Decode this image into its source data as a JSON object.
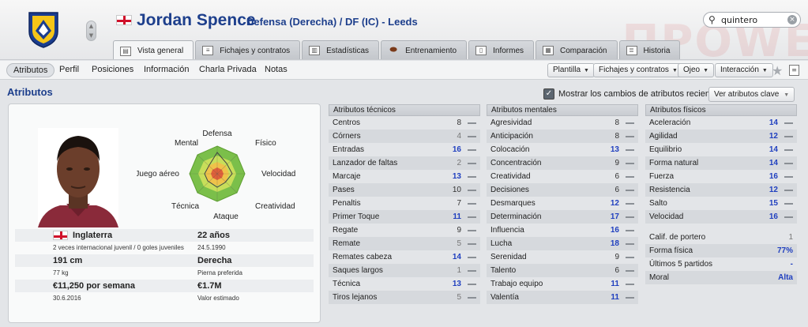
{
  "header": {
    "player_name": "Jordan Spence",
    "player_sub": "Defensa (Derecha) / DF (IC) - Leeds",
    "search_value": "quintero",
    "tabs": [
      {
        "label": "Vista general",
        "active": true
      },
      {
        "label": "Fichajes y contratos"
      },
      {
        "label": "Estadísticas"
      },
      {
        "label": "Entrenamiento"
      },
      {
        "label": "Informes"
      },
      {
        "label": "Comparación"
      },
      {
        "label": "Historia"
      }
    ]
  },
  "subnav": {
    "items": [
      "Atributos",
      "Perfil",
      "Posiciones",
      "Información",
      "Charla Privada",
      "Notas"
    ],
    "dropdowns": [
      "Plantilla",
      "Fichajes y contratos",
      "Ojeo",
      "Interacción"
    ]
  },
  "section": {
    "title": "Atributos",
    "checkbox_label": "Mostrar los cambios de atributos recientes",
    "key_button": "Ver atributos clave"
  },
  "radar_labels": {
    "top": "Defensa",
    "top_left": "Mental",
    "top_right": "Físico",
    "left": "Juego aéreo",
    "right": "Velocidad",
    "bottom_left": "Técnica",
    "bottom_right": "Creatividad",
    "bottom": "Ataque"
  },
  "profile": {
    "nationality": "Inglaterra",
    "caps": "2 veces internacional juvenil / 0 goles juveniles",
    "age": "22 años",
    "dob": "24.5.1990",
    "height": "191 cm",
    "weight": "77 kg",
    "foot": "Derecha",
    "foot_label": "Pierna preferida",
    "wage": "€11,250 por semana",
    "contract_end": "30.6.2016",
    "value": "€1.7M",
    "value_label": "Valor estimado"
  },
  "technical": {
    "title": "Atributos técnicos",
    "rows": [
      {
        "name": "Centros",
        "value": "8"
      },
      {
        "name": "Córners",
        "value": "4"
      },
      {
        "name": "Entradas",
        "value": "16"
      },
      {
        "name": "Lanzador de faltas",
        "value": "2"
      },
      {
        "name": "Marcaje",
        "value": "13"
      },
      {
        "name": "Pases",
        "value": "10"
      },
      {
        "name": "Penaltis",
        "value": "7"
      },
      {
        "name": "Primer Toque",
        "value": "11"
      },
      {
        "name": "Regate",
        "value": "9"
      },
      {
        "name": "Remate",
        "value": "5"
      },
      {
        "name": "Remates cabeza",
        "value": "14"
      },
      {
        "name": "Saques largos",
        "value": "1"
      },
      {
        "name": "Técnica",
        "value": "13"
      },
      {
        "name": "Tiros lejanos",
        "value": "5"
      }
    ]
  },
  "mental": {
    "title": "Atributos mentales",
    "rows": [
      {
        "name": "Agresividad",
        "value": "8"
      },
      {
        "name": "Anticipación",
        "value": "8"
      },
      {
        "name": "Colocación",
        "value": "13"
      },
      {
        "name": "Concentración",
        "value": "9"
      },
      {
        "name": "Creatividad",
        "value": "6"
      },
      {
        "name": "Decisiones",
        "value": "6"
      },
      {
        "name": "Desmarques",
        "value": "12"
      },
      {
        "name": "Determinación",
        "value": "17"
      },
      {
        "name": "Influencia",
        "value": "16"
      },
      {
        "name": "Lucha",
        "value": "18"
      },
      {
        "name": "Serenidad",
        "value": "9"
      },
      {
        "name": "Talento",
        "value": "6"
      },
      {
        "name": "Trabajo equipo",
        "value": "11"
      },
      {
        "name": "Valentía",
        "value": "11"
      }
    ]
  },
  "physical": {
    "title": "Atributos físicos",
    "rows": [
      {
        "name": "Aceleración",
        "value": "14"
      },
      {
        "name": "Agilidad",
        "value": "12"
      },
      {
        "name": "Equilibrio",
        "value": "14"
      },
      {
        "name": "Forma natural",
        "value": "14"
      },
      {
        "name": "Fuerza",
        "value": "16"
      },
      {
        "name": "Resistencia",
        "value": "12"
      },
      {
        "name": "Salto",
        "value": "15"
      },
      {
        "name": "Velocidad",
        "value": "16"
      }
    ],
    "extra": [
      {
        "name": "Calif. de portero",
        "value": "1"
      },
      {
        "name": "Forma física",
        "value": "77%"
      },
      {
        "name": "Últimos 5 partidos",
        "value": "-"
      },
      {
        "name": "Moral",
        "value": "Alta"
      }
    ]
  },
  "colors": {
    "accent": "#1d3f8c",
    "high_value": "#1f3fbf",
    "radar_outer": "#7bbf4a",
    "radar_mid": "#e9d84a",
    "radar_inner": "#e0603a"
  },
  "icons": [
    "club-crest-icon",
    "england-flag-icon",
    "search-icon",
    "clear-icon",
    "star-icon",
    "note-icon",
    "checkbox-icon"
  ]
}
